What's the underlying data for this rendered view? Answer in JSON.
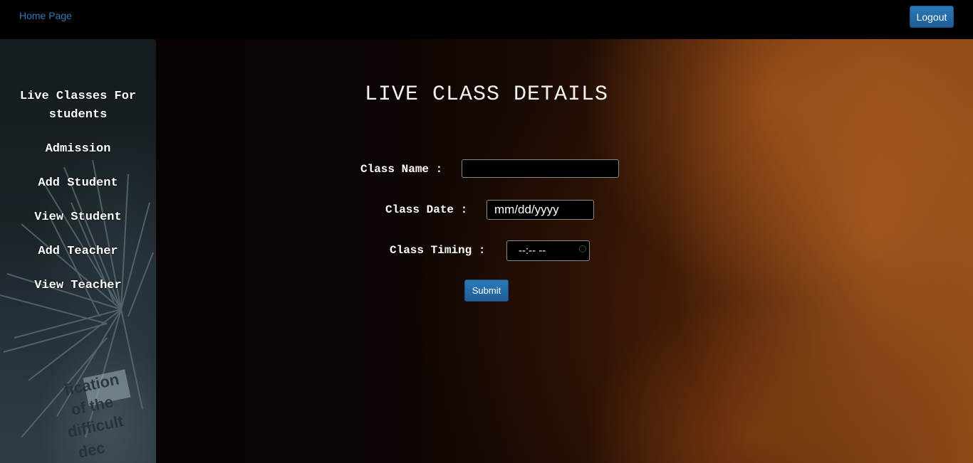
{
  "topbar": {
    "home_link": "Home Page",
    "logout_label": "Logout"
  },
  "sidebar": {
    "items": [
      {
        "label": "Live Classes For students"
      },
      {
        "label": "Admission"
      },
      {
        "label": "Add Student"
      },
      {
        "label": "View Student"
      },
      {
        "label": "Add Teacher"
      },
      {
        "label": "View Teacher"
      }
    ]
  },
  "main": {
    "title": "LIVE CLASS DETAILS",
    "form": {
      "class_name_label": "Class Name :",
      "class_name_value": "",
      "class_date_label": "Class Date :",
      "class_date_placeholder": "mm/dd/yyyy",
      "class_timing_label": "Class Timing :",
      "class_timing_placeholder": "--:-- --",
      "submit_label": "Submit"
    }
  },
  "colors": {
    "link": "#337ab7",
    "button": "#2a7ab8",
    "topbar_bg": "#000000"
  }
}
